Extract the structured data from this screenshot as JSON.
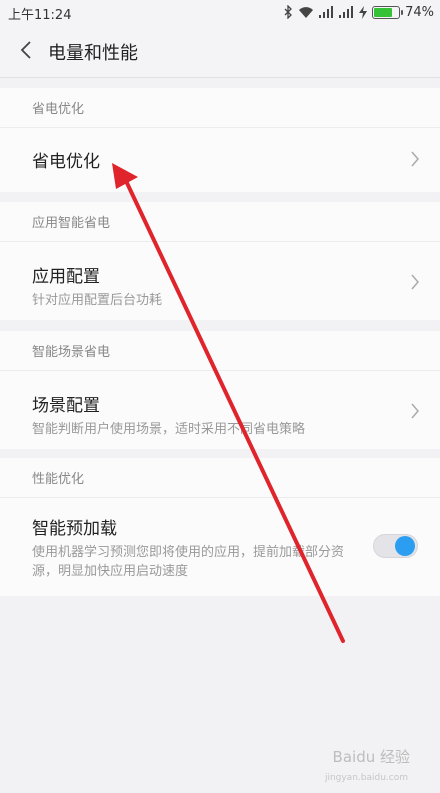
{
  "status_bar": {
    "time": "上午11:24",
    "battery_percent": "74%",
    "battery_level": 0.74
  },
  "nav": {
    "title": "电量和性能"
  },
  "sections": {
    "power_saving": {
      "header": "省电优化",
      "row_title": "省电优化"
    },
    "app_smart": {
      "header": "应用智能省电",
      "row_title": "应用配置",
      "row_sub": "针对应用配置后台功耗"
    },
    "scene_smart": {
      "header": "智能场景省电",
      "row_title": "场景配置",
      "row_sub": "智能判断用户使用场景，适时采用不同省电策略"
    },
    "performance": {
      "header": "性能优化",
      "row_title": "智能预加载",
      "row_sub": "使用机器学习预测您即将使用的应用，提前加载部分资源，明显加快应用启动速度",
      "toggle_on": true
    }
  },
  "watermark": {
    "text": "Baidu 经验",
    "sub": "jingyan.baidu.com"
  },
  "colors": {
    "toggle_accent": "#2b9ef1",
    "annotation_arrow": "#e0242b",
    "battery": "#35c236"
  }
}
